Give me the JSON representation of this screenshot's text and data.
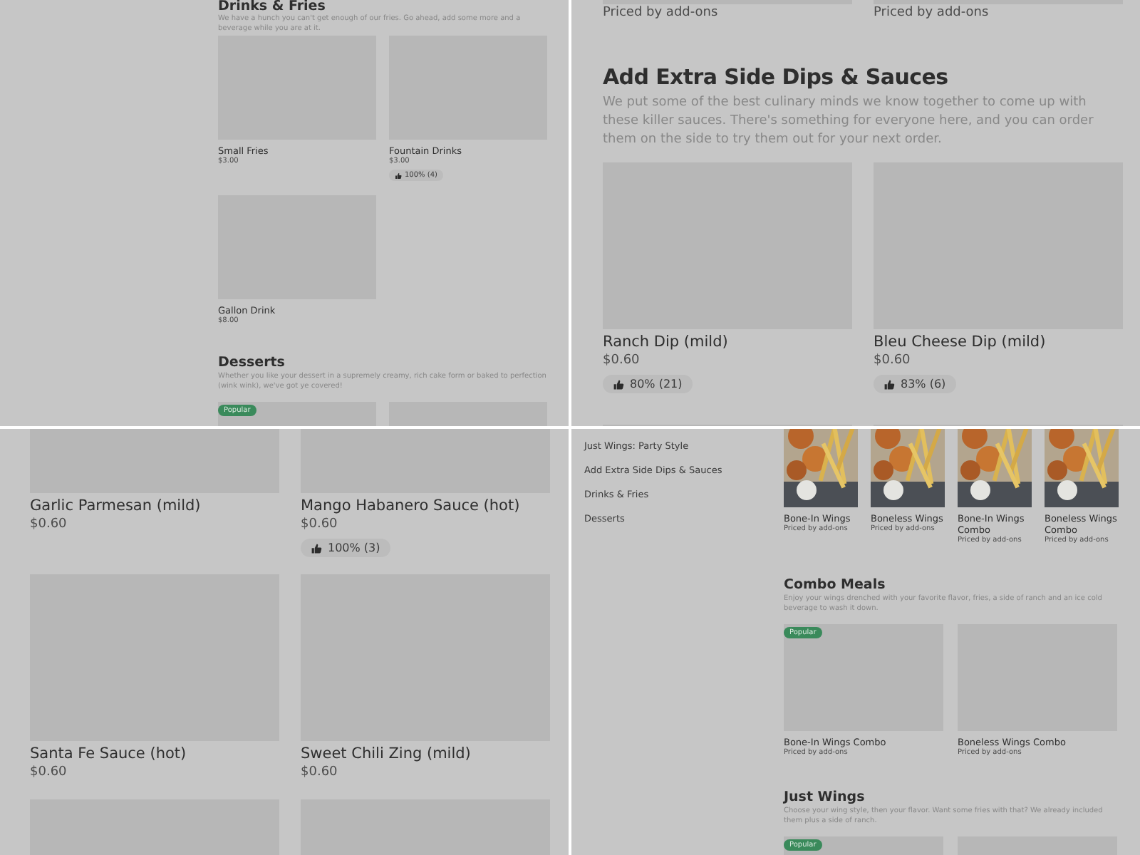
{
  "panels": [
    {
      "kind": "compact",
      "blocks": [
        {
          "kind": "grid",
          "title": "Drinks & Fries",
          "description": "We have a hunch you can't get enough of our fries. Go ahead, add some more and a beverage while you are at it.",
          "items": [
            {
              "name": "Small Fries",
              "price": "$3.00"
            },
            {
              "name": "Fountain Drinks",
              "price": "$3.00",
              "rating": "100% (4)"
            },
            {
              "name": "Gallon Drink",
              "price": "$8.00"
            }
          ]
        },
        {
          "kind": "grid",
          "title": "Desserts",
          "description": "Whether you like your dessert in a supremely creamy, rich cake form or baked to perfection (wink wink), we've got ye covered!",
          "items": [
            {
              "popular": true,
              "badge": "Popular"
            },
            {
              "popular": false
            }
          ]
        }
      ]
    },
    {
      "kind": "wide",
      "blocks": [
        {
          "kind": "grid",
          "items": [
            {
              "price": "Priced by add-ons"
            },
            {
              "price": "Priced by add-ons"
            }
          ]
        },
        {
          "kind": "grid",
          "title": "Add Extra Side Dips & Sauces",
          "description": "We put some of the best culinary minds we know together to come up with these killer sauces. There's something for everyone here, and you can order them on the side to try them out for your next order.",
          "items": [
            {
              "name": "Ranch Dip (mild)",
              "price": "$0.60",
              "rating": "80% (21)"
            },
            {
              "name": "Bleu Cheese Dip (mild)",
              "price": "$0.60",
              "rating": "83% (6)"
            },
            {
              "popular": false
            },
            {
              "popular": false
            }
          ]
        }
      ]
    },
    {
      "kind": "wide",
      "blocks": [
        {
          "kind": "grid",
          "items": [
            {
              "name": "Garlic Parmesan (mild)",
              "price": "$0.60"
            },
            {
              "name": "Mango Habanero Sauce (hot)",
              "price": "$0.60",
              "rating": "100% (3)"
            },
            {
              "name": "Santa Fe Sauce (hot)",
              "price": "$0.60"
            },
            {
              "name": "Sweet Chili Zing (mild)",
              "price": "$0.60"
            },
            {
              "popular": false
            },
            {
              "popular": false
            }
          ]
        }
      ]
    },
    {
      "kind": "compact",
      "sidebar": [
        "Just Wings: Party Style",
        "Add Extra Side Dips & Sauces",
        "Drinks & Fries",
        "Desserts"
      ],
      "blocks": [
        {
          "kind": "carousel",
          "items": [
            {
              "name": "Bone-In Wings",
              "price": "Priced by add-ons"
            },
            {
              "name": "Boneless Wings",
              "price": "Priced by add-ons"
            },
            {
              "name": "Bone-In Wings Combo",
              "price": "Priced by add-ons"
            },
            {
              "name": "Boneless Wings Combo",
              "price": "Priced by add-ons"
            }
          ]
        },
        {
          "kind": "grid",
          "title": "Combo Meals",
          "description": "Enjoy your wings drenched with your favorite flavor, fries, a side of ranch and an ice cold beverage to wash it down.",
          "items": [
            {
              "name": "Bone-In Wings Combo",
              "price": "Priced by add-ons",
              "popular": true,
              "badge": "Popular"
            },
            {
              "name": "Boneless Wings Combo",
              "price": "Priced by add-ons",
              "popular": false
            }
          ]
        },
        {
          "kind": "grid",
          "title": "Just Wings",
          "description": "Choose your wing style, then your flavor. Want some fries with that? We already included them plus a side of ranch.",
          "items": [
            {
              "popular": true,
              "badge": "Popular"
            },
            {
              "popular": false
            }
          ]
        }
      ]
    }
  ]
}
